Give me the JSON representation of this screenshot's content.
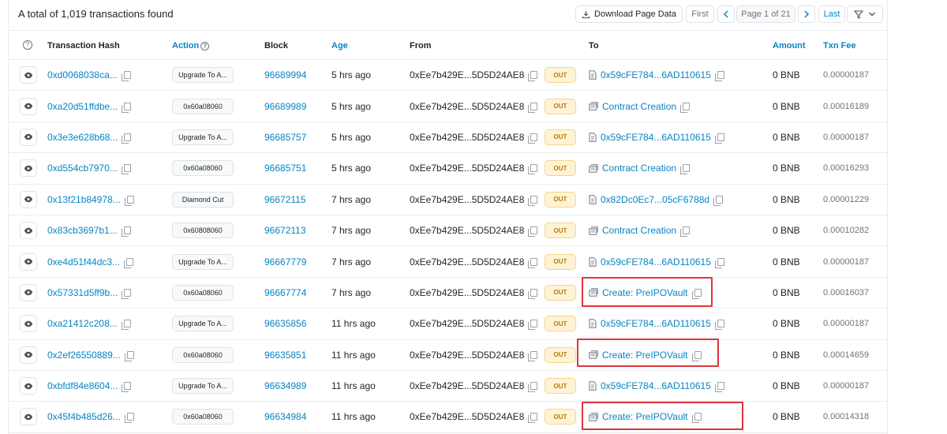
{
  "summary": {
    "total_text": "A total of 1,019 transactions found"
  },
  "toolbar": {
    "download_label": "Download Page Data",
    "first_label": "First",
    "page_info": "Page 1 of 21",
    "last_label": "Last"
  },
  "columns": {
    "hash": "Transaction Hash",
    "action": "Action",
    "block": "Block",
    "age": "Age",
    "from": "From",
    "to": "To",
    "amount": "Amount",
    "fee": "Txn Fee"
  },
  "rows": [
    {
      "hash": "0xd0068038ca...",
      "action": "Upgrade To A...",
      "block": "96689994",
      "age": "5 hrs ago",
      "from": "0xEe7b429E...5D5D24AE8",
      "direction": "OUT",
      "to": "0x59cFE784...6AD110615",
      "to_type": "contract",
      "amount": "0 BNB",
      "fee": "0.00000187"
    },
    {
      "hash": "0xa20d51ffdbe...",
      "action": "0x60a08060",
      "block": "96689989",
      "age": "5 hrs ago",
      "from": "0xEe7b429E...5D5D24AE8",
      "direction": "OUT",
      "to": "Contract Creation",
      "to_type": "creation",
      "amount": "0 BNB",
      "fee": "0.00016189"
    },
    {
      "hash": "0x3e3e628b68...",
      "action": "Upgrade To A...",
      "block": "96685757",
      "age": "5 hrs ago",
      "from": "0xEe7b429E...5D5D24AE8",
      "direction": "OUT",
      "to": "0x59cFE784...6AD110615",
      "to_type": "contract",
      "amount": "0 BNB",
      "fee": "0.00000187"
    },
    {
      "hash": "0xd554cb7970...",
      "action": "0x60a08060",
      "block": "96685751",
      "age": "5 hrs ago",
      "from": "0xEe7b429E...5D5D24AE8",
      "direction": "OUT",
      "to": "Contract Creation",
      "to_type": "creation",
      "amount": "0 BNB",
      "fee": "0.00016293"
    },
    {
      "hash": "0x13f21b84978...",
      "action": "Diamond Cut",
      "block": "96672115",
      "age": "7 hrs ago",
      "from": "0xEe7b429E...5D5D24AE8",
      "direction": "OUT",
      "to": "0x82Dc0Ec7...05cF6788d",
      "to_type": "contract",
      "amount": "0 BNB",
      "fee": "0.00001229"
    },
    {
      "hash": "0x83cb3697b1...",
      "action": "0x60808060",
      "block": "96672113",
      "age": "7 hrs ago",
      "from": "0xEe7b429E...5D5D24AE8",
      "direction": "OUT",
      "to": "Contract Creation",
      "to_type": "creation",
      "amount": "0 BNB",
      "fee": "0.00010282"
    },
    {
      "hash": "0xe4d51f44dc3...",
      "action": "Upgrade To A...",
      "block": "96667779",
      "age": "7 hrs ago",
      "from": "0xEe7b429E...5D5D24AE8",
      "direction": "OUT",
      "to": "0x59cFE784...6AD110615",
      "to_type": "contract",
      "amount": "0 BNB",
      "fee": "0.00000187"
    },
    {
      "hash": "0x57331d5ff9b...",
      "action": "0x60a08060",
      "block": "96667774",
      "age": "7 hrs ago",
      "from": "0xEe7b429E...5D5D24AE8",
      "direction": "OUT",
      "to": "Create: PreIPOVault",
      "to_type": "creation",
      "amount": "0 BNB",
      "fee": "0.00016037"
    },
    {
      "hash": "0xa21412c208...",
      "action": "Upgrade To A...",
      "block": "96635856",
      "age": "11 hrs ago",
      "from": "0xEe7b429E...5D5D24AE8",
      "direction": "OUT",
      "to": "0x59cFE784...6AD110615",
      "to_type": "contract",
      "amount": "0 BNB",
      "fee": "0.00000187"
    },
    {
      "hash": "0x2ef26550889...",
      "action": "0x60a08060",
      "block": "96635851",
      "age": "11 hrs ago",
      "from": "0xEe7b429E...5D5D24AE8",
      "direction": "OUT",
      "to": "Create: PreIPOVault",
      "to_type": "creation",
      "amount": "0 BNB",
      "fee": "0.00014659"
    },
    {
      "hash": "0xbfdf84e8604...",
      "action": "Upgrade To A...",
      "block": "96634989",
      "age": "11 hrs ago",
      "from": "0xEe7b429E...5D5D24AE8",
      "direction": "OUT",
      "to": "0x59cFE784...6AD110615",
      "to_type": "contract",
      "amount": "0 BNB",
      "fee": "0.00000187"
    },
    {
      "hash": "0x45f4b485d26...",
      "action": "0x60a08060",
      "block": "96634984",
      "age": "11 hrs ago",
      "from": "0xEe7b429E...5D5D24AE8",
      "direction": "OUT",
      "to": "Create: PreIPOVault",
      "to_type": "creation",
      "amount": "0 BNB",
      "fee": "0.00014318"
    }
  ],
  "colors": {
    "link": "#0784c3",
    "highlight": "#e0343c",
    "out_badge_bg": "#fff3d6",
    "out_badge_text": "#b47d00"
  },
  "icons": [
    "download-icon",
    "chevron-left-icon",
    "chevron-right-icon",
    "filter-icon",
    "eye-icon",
    "copy-icon",
    "contract-file-icon",
    "contract-creation-icon",
    "info-icon",
    "question-icon"
  ]
}
